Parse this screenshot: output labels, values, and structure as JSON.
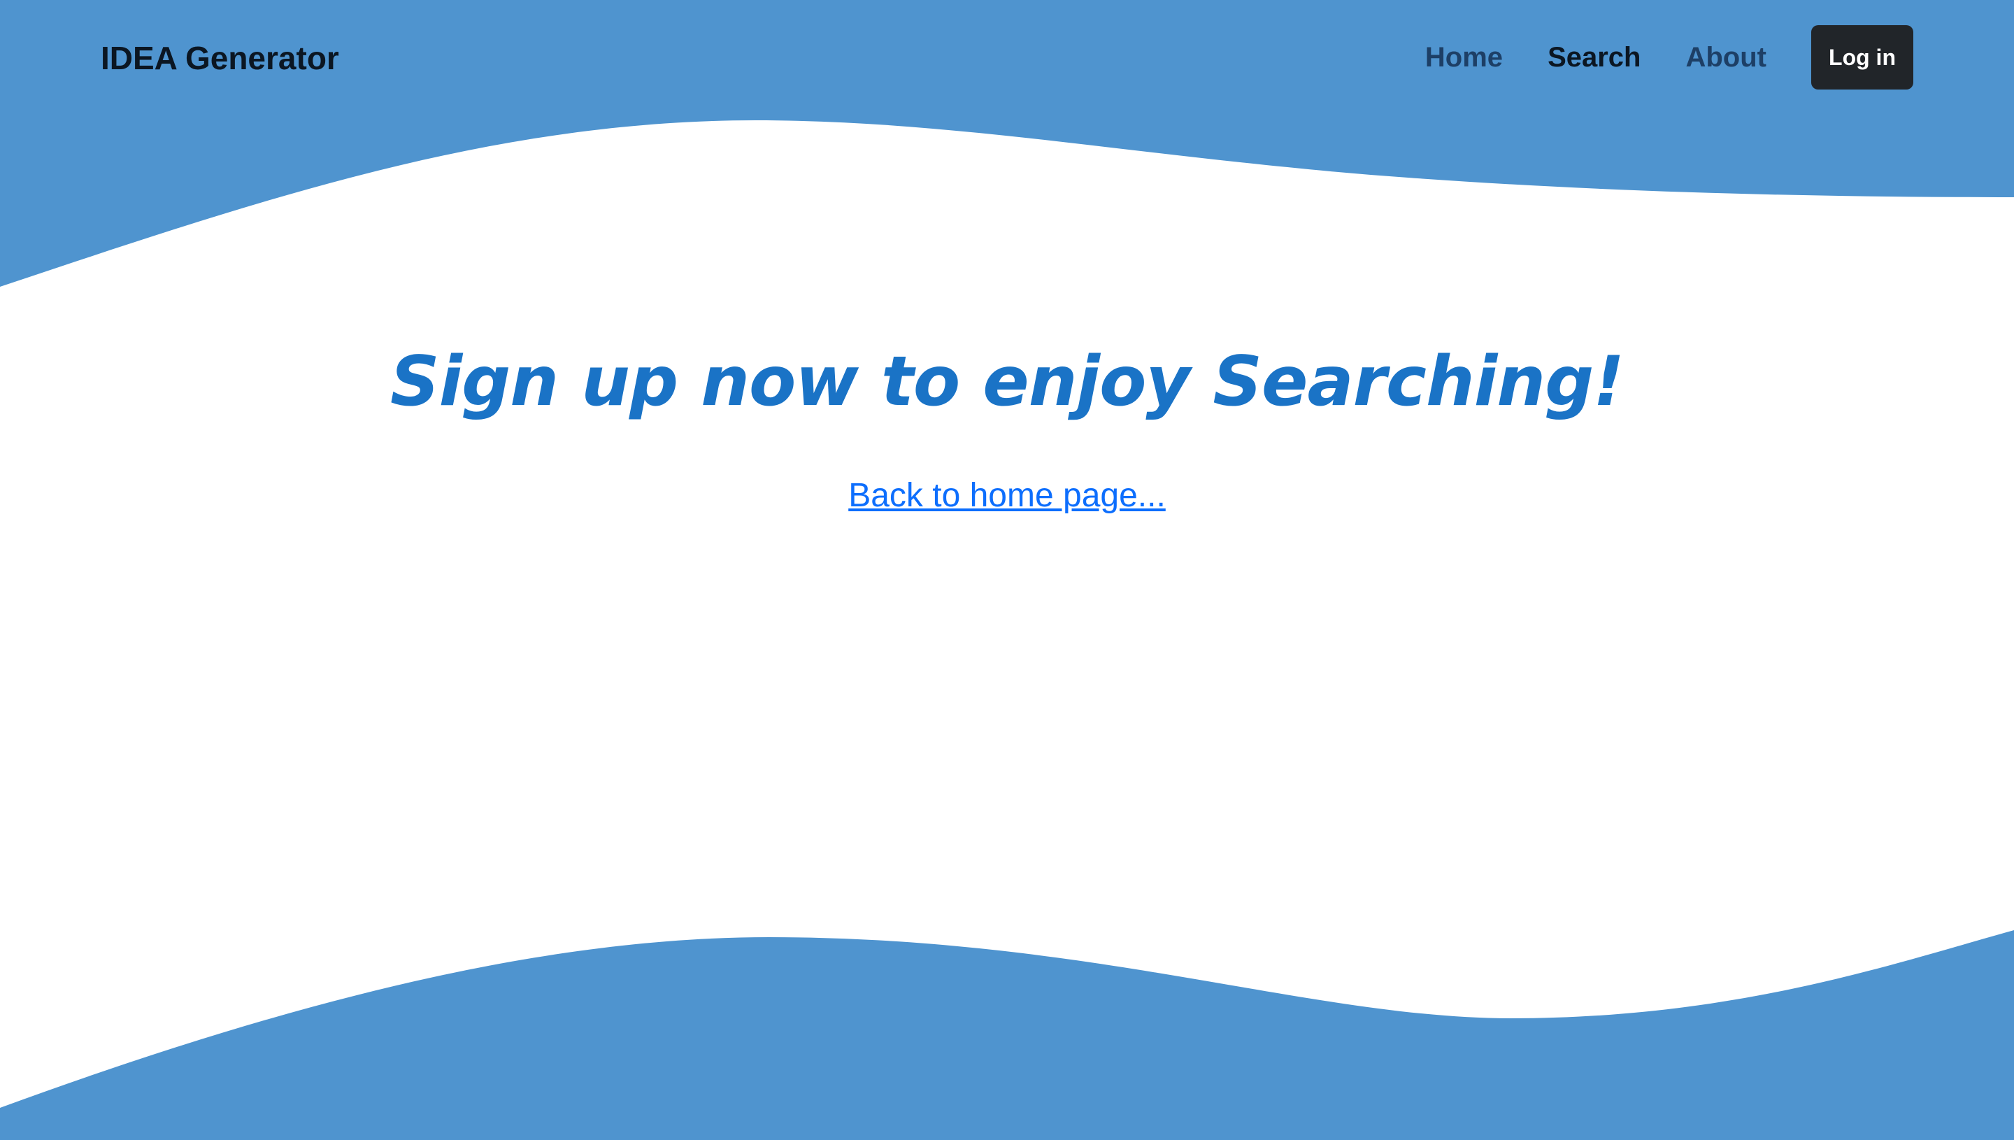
{
  "colors": {
    "wave": "#4F94CF",
    "headline": "#1A73C6",
    "link": "#0D6EFD",
    "login_button_bg": "#212529"
  },
  "navbar": {
    "brand": "IDEA Generator",
    "links": [
      {
        "label": "Home",
        "active": false
      },
      {
        "label": "Search",
        "active": true
      },
      {
        "label": "About",
        "active": false
      }
    ],
    "login_label": "Log in"
  },
  "main": {
    "headline": "Sign up now to enjoy Searching!",
    "back_link": "Back to home page..."
  }
}
